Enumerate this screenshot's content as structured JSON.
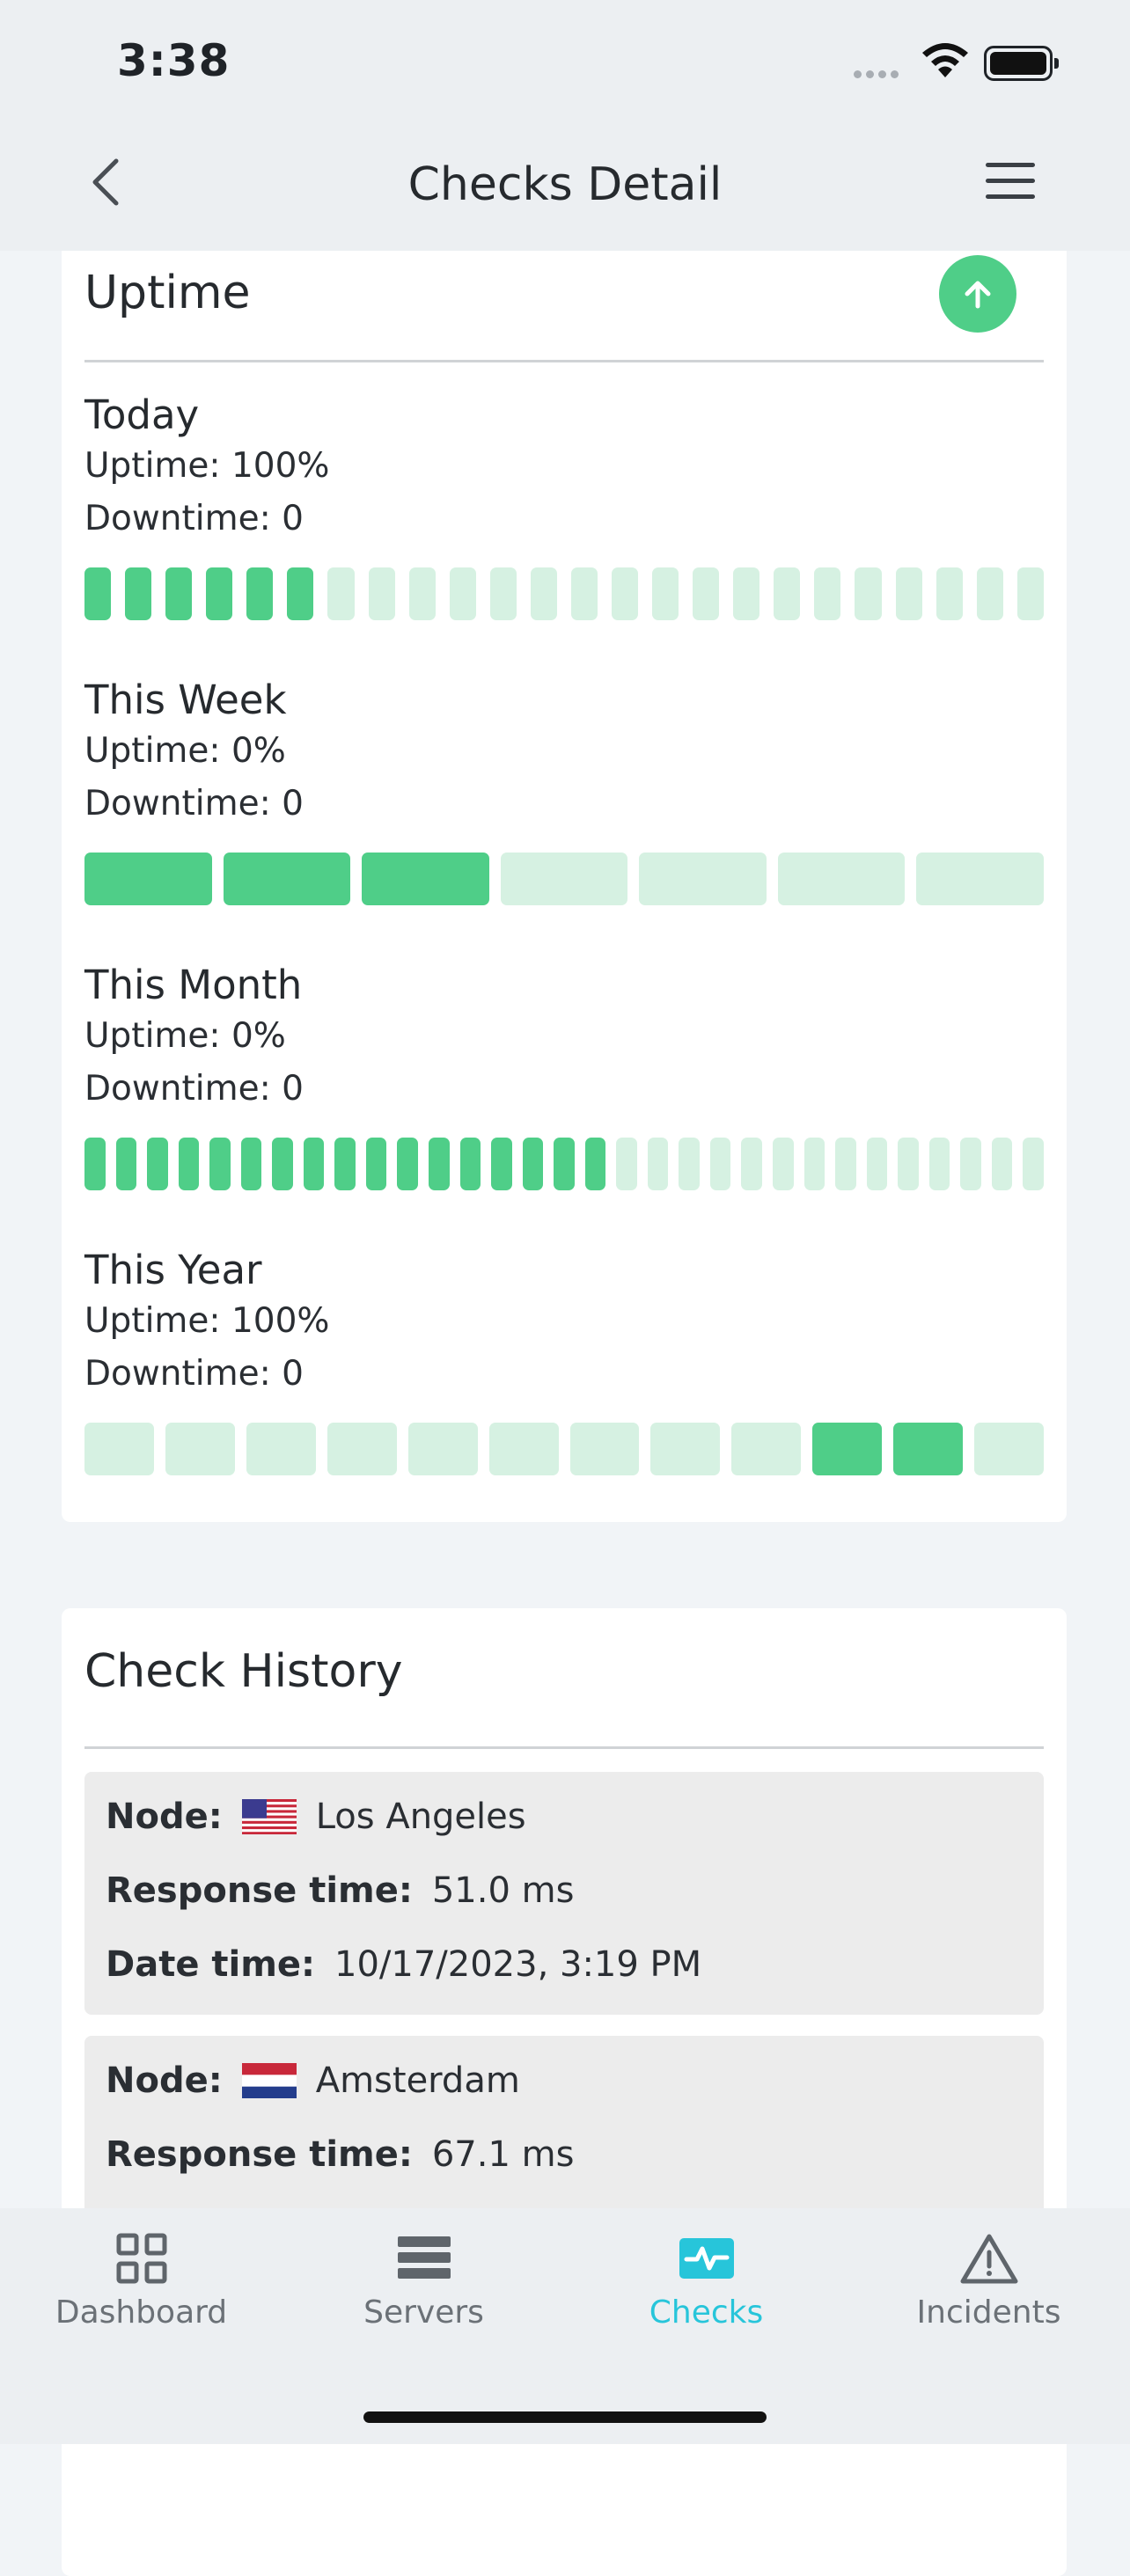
{
  "status_bar": {
    "time": "3:38"
  },
  "nav": {
    "title": "Checks Detail"
  },
  "uptime_card": {
    "title": "Uptime",
    "periods": [
      {
        "title": "Today",
        "uptime": "Uptime: 100%",
        "downtime": "Downtime: 0",
        "bars_total": 24,
        "bars_filled": 6
      },
      {
        "title": "This Week",
        "uptime": "Uptime: 0%",
        "downtime": "Downtime: 0",
        "bars_total": 7,
        "bars_filled": 3
      },
      {
        "title": "This Month",
        "uptime": "Uptime: 0%",
        "downtime": "Downtime: 0",
        "bars_total": 31,
        "bars_filled": 17
      },
      {
        "title": "This Year",
        "uptime": "Uptime: 100%",
        "downtime": "Downtime: 0",
        "bars_total": 12,
        "bars_filled_positions": [
          9,
          10
        ]
      }
    ]
  },
  "history_card": {
    "title": "Check History",
    "node_label": "Node:",
    "response_label": "Response time:",
    "date_label": "Date time:",
    "items": [
      {
        "flag": "us-flag",
        "node": "Los Angeles",
        "response_time": "51.0 ms",
        "date_time": "10/17/2023, 3:19 PM"
      },
      {
        "flag": "nl-flag",
        "node": "Amsterdam",
        "response_time": "67.1 ms",
        "date_time": ""
      }
    ]
  },
  "tabs": [
    {
      "label": "Dashboard",
      "icon": "grid-icon",
      "active": false
    },
    {
      "label": "Servers",
      "icon": "servers-icon",
      "active": false
    },
    {
      "label": "Checks",
      "icon": "pulse-icon",
      "active": true
    },
    {
      "label": "Incidents",
      "icon": "warning-icon",
      "active": false
    }
  ],
  "colors": {
    "up": "#4fce88",
    "up_light": "#d6f1e2",
    "accent": "#27c5da"
  }
}
